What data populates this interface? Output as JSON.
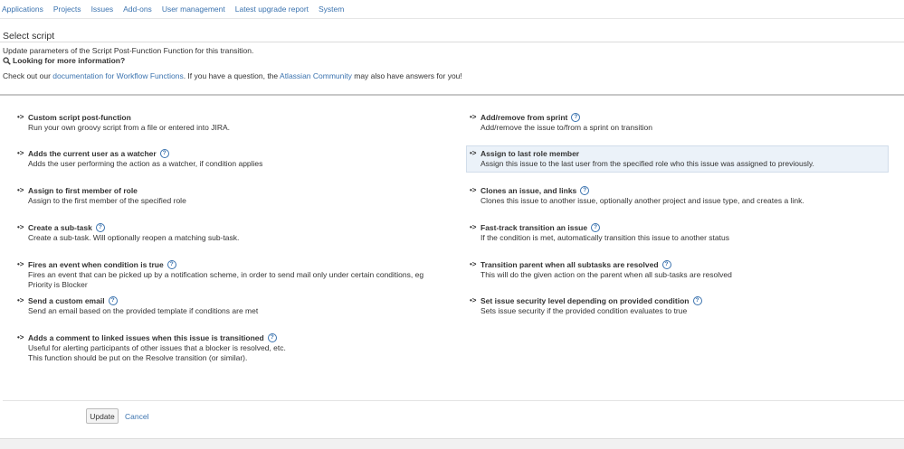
{
  "nav": {
    "items": [
      "Applications",
      "Projects",
      "Issues",
      "Add-ons",
      "User management",
      "Latest upgrade report",
      "System"
    ]
  },
  "header": {
    "title": "Select script",
    "description": "Update parameters of the Script Post-Function Function for this transition.",
    "more_info": "Looking for more information?",
    "checkout_prefix": "Check out our ",
    "doc_link": "documentation for Workflow Functions",
    "checkout_middle": ". If you have a question, the ",
    "community_link": "Atlassian Community",
    "checkout_suffix": " may also have answers for you!"
  },
  "scripts_left": [
    {
      "title": "Custom script post-function",
      "desc": "Run your own groovy script from a file or entered into JIRA.",
      "help": false
    },
    {
      "title": "Adds the current user as a watcher",
      "desc": "Adds the user performing the action as a watcher, if condition applies",
      "help": true
    },
    {
      "title": "Assign to first member of role",
      "desc": "Assign to the first member of the specified role",
      "help": false
    },
    {
      "title": "Create a sub-task",
      "desc": "Create a sub-task. Will optionally reopen a matching sub-task.",
      "help": true
    },
    {
      "title": "Fires an event when condition is true",
      "desc": "Fires an event that can be picked up by a notification scheme, in order to send mail only under certain conditions, eg Priority is Blocker",
      "help": true
    },
    {
      "title": "Send a custom email",
      "desc": "Send an email based on the provided template if conditions are met",
      "help": true
    },
    {
      "title": "Adds a comment to linked issues when this issue is transitioned",
      "desc": "Useful for alerting participants of other issues that a blocker is resolved, etc.",
      "desc2": "This function should be put on the Resolve transition (or similar).",
      "help": true
    }
  ],
  "scripts_right": [
    {
      "title": "Add/remove from sprint",
      "desc": "Add/remove the issue to/from a sprint on transition",
      "help": true
    },
    {
      "title": "Assign to last role member",
      "desc": "Assign this issue to the last user from the specified role who this issue was assigned to previously.",
      "help": false,
      "selected": true
    },
    {
      "title": "Clones an issue, and links",
      "desc": "Clones this issue to another issue, optionally another project and issue type, and creates a link.",
      "help": true
    },
    {
      "title": "Fast-track transition an issue",
      "desc": "If the condition is met, automatically transition this issue to another status",
      "help": true
    },
    {
      "title": "Transition parent when all subtasks are resolved",
      "desc": "This will do the given action on the parent when all sub-tasks are resolved",
      "help": true
    },
    {
      "title": "Set issue security level depending on provided condition",
      "desc": "Sets issue security if the provided condition evaluates to true",
      "help": true
    }
  ],
  "footer": {
    "update_label": "Update",
    "cancel_label": "Cancel"
  },
  "icons": {
    "arrow": "arrow-right-icon",
    "help": "question-circle-icon",
    "search": "search-icon",
    "help_glyph": "?",
    "arrow_glyph": "•>"
  },
  "colors": {
    "link": "#3b73af",
    "selected_bg": "#ebf2f9"
  }
}
